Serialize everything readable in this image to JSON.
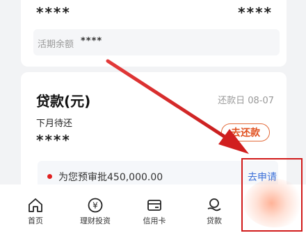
{
  "account": {
    "left_masked": "****",
    "right_masked": "****"
  },
  "balance": {
    "label": "活期余额",
    "value": "****"
  },
  "loan": {
    "title": "贷款(元)",
    "repay_day": "还款日 08-07",
    "next_month_label": "下月待还",
    "amount_masked": "****",
    "repay_button": "去还款",
    "preapproval_text": "为您预审批450,000.00",
    "apply_link": "去申请"
  },
  "tabbar": {
    "home": "首页",
    "wealth": "理财投资",
    "credit_card": "信用卡",
    "loan": "贷款"
  },
  "icons": {
    "wealth_symbol": "¥"
  },
  "colors": {
    "accent": "#e0501f",
    "link": "#3a6fd8",
    "annotation_red": "#d11919"
  }
}
